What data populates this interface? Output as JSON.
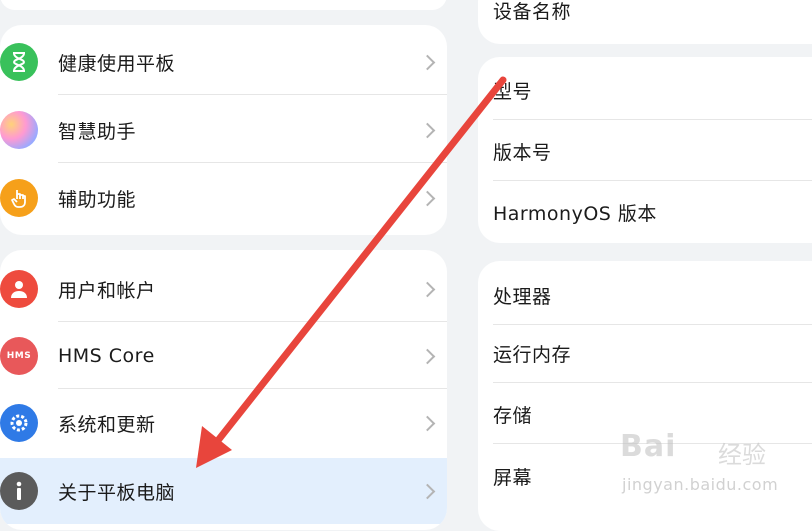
{
  "left_menu": {
    "group1": [
      {
        "label": "健康使用平板",
        "icon": "hourglass-icon"
      },
      {
        "label": "智慧助手",
        "icon": "assistant-orb-icon"
      },
      {
        "label": "辅助功能",
        "icon": "hand-icon"
      }
    ],
    "group2": [
      {
        "label": "用户和帐户",
        "icon": "user-icon"
      },
      {
        "label": "HMS Core",
        "icon": "hms-icon",
        "icon_text": "HMS"
      },
      {
        "label": "系统和更新",
        "icon": "gear-icon"
      },
      {
        "label": "关于平板电脑",
        "icon": "info-icon",
        "selected": true
      }
    ]
  },
  "about_panel": {
    "group0": [
      {
        "label": "设备名称"
      }
    ],
    "group1": [
      {
        "label": "型号"
      },
      {
        "label": "版本号"
      },
      {
        "label": "HarmonyOS 版本"
      }
    ],
    "group2": [
      {
        "label": "处理器"
      },
      {
        "label": "运行内存"
      },
      {
        "label": "存储"
      },
      {
        "label": "屏幕"
      }
    ]
  },
  "annotation": {
    "arrow_color": "#e8453c"
  },
  "watermark": {
    "brand": "Bai",
    "brand_suffix": "经验",
    "url": "jingyan.baidu.com"
  },
  "colors": {
    "selected_bg": "#e3effd",
    "background": "#f1f3f5"
  }
}
